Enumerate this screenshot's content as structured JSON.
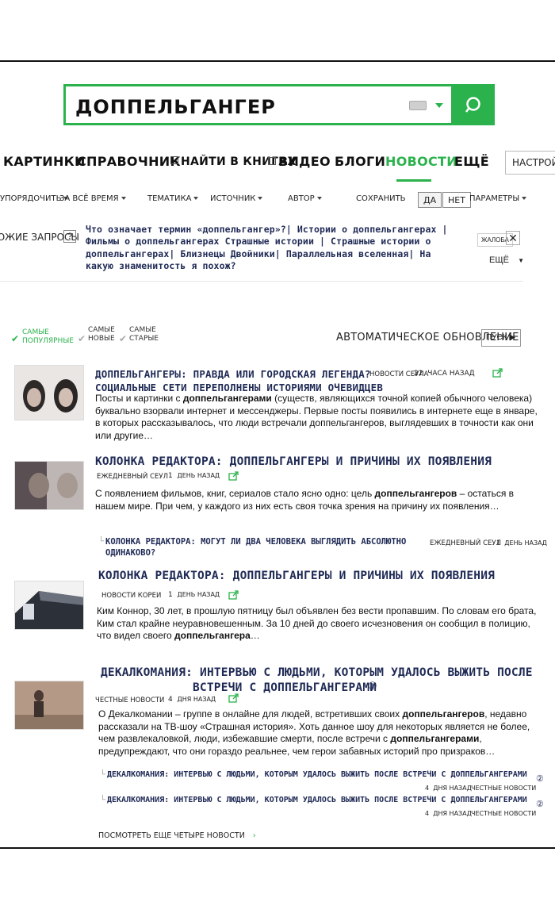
{
  "search": {
    "query": "ДОППЕЛЬГАНГЕР"
  },
  "tabs": [
    {
      "label": "КАРТИНКИ"
    },
    {
      "label": "СПРАВОЧНИК"
    },
    {
      "label": "НАЙТИ В КНИГАХ"
    },
    {
      "label": "ВИДЕО"
    },
    {
      "label": "БЛОГИ"
    },
    {
      "label": "НОВОСТИ"
    },
    {
      "label": "ЕЩЁ"
    }
  ],
  "settings_label": "НАСТРОЙКИ",
  "filters": {
    "sort": "УПОРЯДОЧИТЬ",
    "period": "ЗА ВСЁ ВРЕМЯ",
    "topic": "ТЕМАТИКА",
    "source": "ИСТОЧНИК",
    "author": "АВТОР",
    "save": "СОХРАНИТЬ",
    "yes": "ДА",
    "no": "НЕТ",
    "params": "ПАРАМЕТРЫ"
  },
  "related": {
    "label": "ПОХОЖИЕ ЗАПРОСЫ",
    "help": "?",
    "text": "Что означает термин «доппельгангер»?| Истории о доппельгангерах | Фильмы о доппельгангерах Страшные истории | Страшные истории о доппельгангерах| Близнецы Двойники| Параллельная вселенная| На какую знаменитость я похож?",
    "complaint": "ЖАЛОБА",
    "close": "✕",
    "more": "ЕЩЁ"
  },
  "sorting": {
    "popular": "САМЫЕ ПОПУЛЯРНЫЕ",
    "newest": "САМЫЕ НОВЫЕ",
    "oldest": "САМЫЕ СТАРЫЕ",
    "auto_update": "АВТОМАТИЧЕСКОЕ ОБНОВЛЕНИЕ",
    "play": "ПУСК"
  },
  "news": [
    {
      "title_line1": "ДОППЕЛЬГАНГЕРЫ: ПРАВДА ИЛИ ГОРОДСКАЯ ЛЕГЕНДА?",
      "title_line2": "СОЦИАЛЬНЫЕ СЕТИ ПЕРЕПОЛНЕНЫ ИСТОРИЯМИ ОЧЕВИДЦЕВ",
      "source": "НОВОСТИ СЕУЛА",
      "age_num": "22",
      "age_unit": "ЧАСА НАЗАД",
      "snippet_1": "Посты и картинки с ",
      "snippet_b": "доппельгангерами",
      "snippet_2": " (существ, являющихся точной копией обычного человека) буквально взорвали интернет и мессенджеры. Первые посты появились в интернете еще в январе, в которых рассказывалось, что люди встречали доппельгангеров, выглядевших в точности как они или другие…"
    },
    {
      "title": "КОЛОНКА РЕДАКТОРА: ДОППЕЛЬГАНГЕРЫ И ПРИЧИНЫ ИХ ПОЯВЛЕНИЯ",
      "source": "ЕЖЕДНЕВНЫЙ СЕУЛ",
      "age_num": "1",
      "age_unit": "ДЕНЬ НАЗАД",
      "snippet_1": "С появлением фильмов, книг, сериалов стало ясно одно: цель ",
      "snippet_b": "доппельгангеров",
      "snippet_2": " – остаться в нашем мире. При чем, у каждого из них есть своя точка зрения на причину их появления…",
      "sub_title": "КОЛОНКА РЕДАКТОРА: МОГУТ ЛИ ДВА ЧЕЛОВЕКА ВЫГЛЯДИТЬ АБСОЛЮТНО ОДИНАКОВО?",
      "sub_source": "ЕЖЕДНЕВНЫЙ СЕУЛ",
      "sub_age_num": "1",
      "sub_age_unit": "ДЕНЬ НАЗАД"
    },
    {
      "title": "КОЛОНКА РЕДАКТОРА: ДОППЕЛЬГАНГЕРЫ И ПРИЧИНЫ ИХ ПОЯВЛЕНИЯ",
      "source": "НОВОСТИ КОРЕИ",
      "age_num": "1",
      "age_unit": "ДЕНЬ НАЗАД",
      "snippet_1": "Ким Коннор, 30 лет, в прошлую пятницу был объявлен без вести пропавшим. По словам его брата, Ким стал крайне неуравновешенным. За 10 дней до своего исчезновения он сообщил в полицию, что видел своего ",
      "snippet_b": "доппельгангера",
      "snippet_2": "…"
    },
    {
      "title_line1": "ДЕКАЛКОМАНИЯ: ИНТЕРВЬЮ С ЛЮДЬМИ, КОТОРЫМ УДАЛОСЬ ВЫЖИТЬ ПОСЛЕ",
      "title_line2": "ВСТРЕЧИ С ДОППЕЛЬГАНГЕРАМИ",
      "title_mark": "①",
      "source": "ЧЕСТНЫЕ НОВОСТИ",
      "age_num": "4",
      "age_unit": "ДНЯ НАЗАД",
      "snippet_1": "О Декалкомании – группе в онлайне для людей, встретивших своих ",
      "snippet_b": "доппельгангеров",
      "snippet_2": ", недавно рассказали на ТВ-шоу «Страшная история». Хоть данное шоу для некоторых является не более, чем развлекаловкой, люди, избежавшие смерти, после встречи с ",
      "snippet_b2": "доппельгангерами",
      "snippet_3": ", предупреждают, что они гораздо реальнее, чем герои забавных историй про призраков…",
      "subs": [
        {
          "title": "ДЕКАЛКОМАНИЯ: ИНТЕРВЬЮ С ЛЮДЬМИ, КОТОРЫМ УДАЛОСЬ ВЫЖИТЬ ПОСЛЕ ВСТРЕЧИ С ДОППЕЛЬГАНГЕРАМИ",
          "mark": "②",
          "age_num": "4",
          "age_unit": "ДНЯ НАЗАД",
          "source": "ЧЕСТНЫЕ НОВОСТИ"
        },
        {
          "title": "ДЕКАЛКОМАНИЯ: ИНТЕРВЬЮ С ЛЮДЬМИ, КОТОРЫМ УДАЛОСЬ ВЫЖИТЬ ПОСЛЕ ВСТРЕЧИ С ДОППЕЛЬГАНГЕРАМИ",
          "mark": "②",
          "age_num": "4",
          "age_unit": "ДНЯ НАЗАД",
          "source": "ЧЕСТНЫЕ НОВОСТИ"
        }
      ]
    }
  ],
  "more_news": "ПОСМОТРЕТЬ ЕЩЕ ЧЕТЫРЕ НОВОСТИ",
  "colors": {
    "accent": "#2bb24c",
    "link": "#1f2a55"
  },
  "icons": [
    "keyboard-icon",
    "search-icon",
    "share-icon",
    "chevron-right-icon",
    "check-icon",
    "close-icon"
  ]
}
